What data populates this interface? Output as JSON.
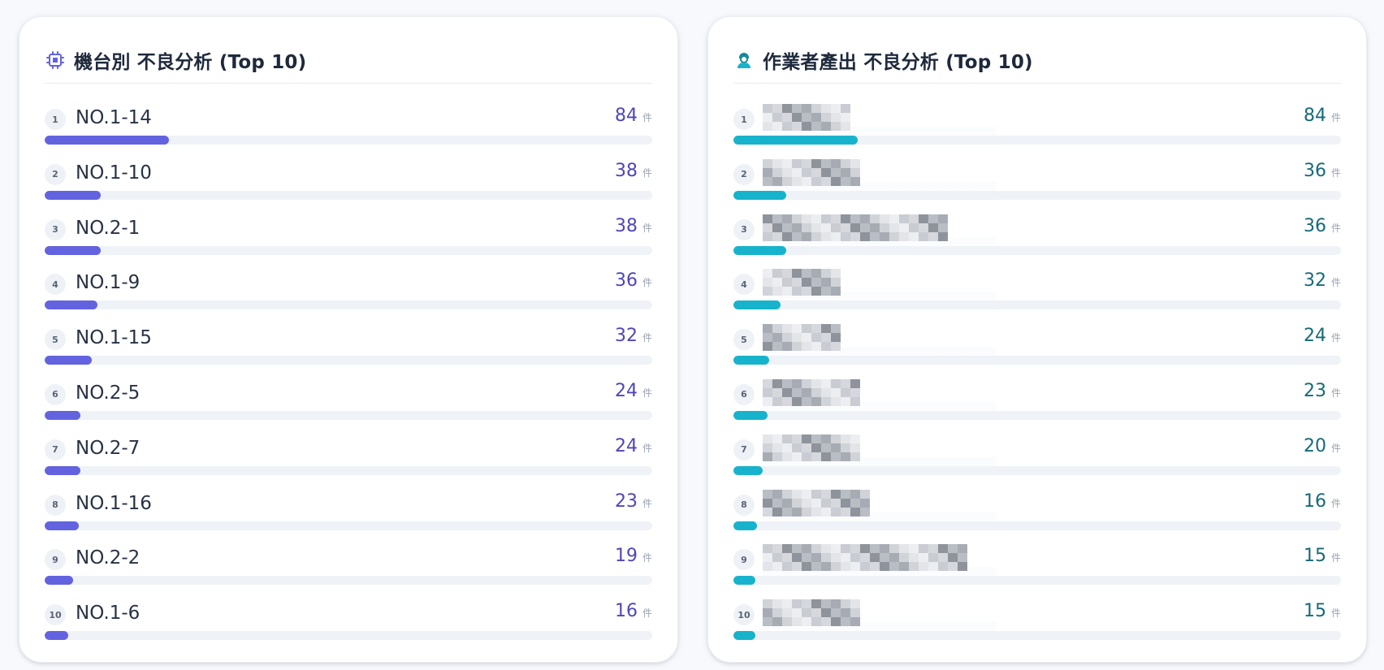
{
  "machine_panel": {
    "title": "機台別 不良分析 (Top 10)",
    "icon": "cpu-chip-icon",
    "accent": "#6363e0",
    "max_value": 84,
    "unit": "件",
    "items": [
      {
        "rank": "1",
        "name": "NO.1-14",
        "value": 84
      },
      {
        "rank": "2",
        "name": "NO.1-10",
        "value": 38
      },
      {
        "rank": "3",
        "name": "NO.2-1",
        "value": 38
      },
      {
        "rank": "4",
        "name": "NO.1-9",
        "value": 36
      },
      {
        "rank": "5",
        "name": "NO.1-15",
        "value": 32
      },
      {
        "rank": "6",
        "name": "NO.2-5",
        "value": 24
      },
      {
        "rank": "7",
        "name": "NO.2-7",
        "value": 24
      },
      {
        "rank": "8",
        "name": "NO.1-16",
        "value": 23
      },
      {
        "rank": "9",
        "name": "NO.2-2",
        "value": 19
      },
      {
        "rank": "10",
        "name": "NO.1-6",
        "value": 16
      }
    ]
  },
  "operator_panel": {
    "title": "作業者產出 不良分析 (Top 10)",
    "icon": "operator-icon",
    "accent": "#17b3cc",
    "max_value": 84,
    "unit": "件",
    "items": [
      {
        "rank": "1",
        "value": 84
      },
      {
        "rank": "2",
        "value": 36
      },
      {
        "rank": "3",
        "value": 36
      },
      {
        "rank": "4",
        "value": 32
      },
      {
        "rank": "5",
        "value": 24
      },
      {
        "rank": "6",
        "value": 23
      },
      {
        "rank": "7",
        "value": 20
      },
      {
        "rank": "8",
        "value": 16
      },
      {
        "rank": "9",
        "value": 15
      },
      {
        "rank": "10",
        "value": 15
      }
    ]
  }
}
